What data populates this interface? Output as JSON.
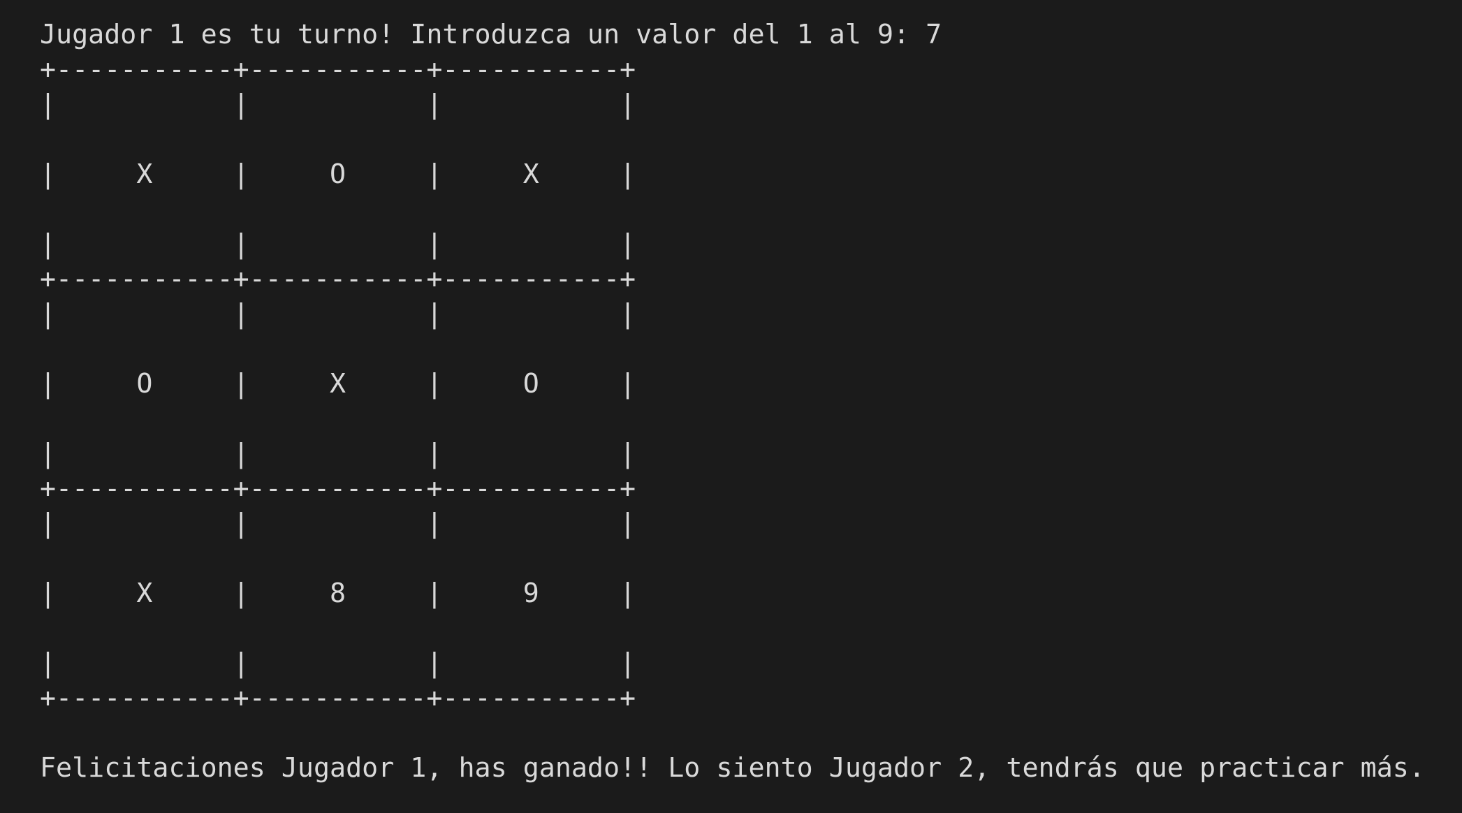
{
  "terminal": {
    "prompt_line": "Jugador 1 es tu turno! Introduzca un valor del 1 al 9: 7",
    "board": {
      "border_line": "+-----------+-----------+-----------+",
      "spacer_line": "|           |           |           |",
      "row1": "|     X     |     O     |     X     |",
      "row2": "|     O     |     X     |     O     |",
      "row3": "|     X     |     8     |     9     |",
      "cells": [
        "X",
        "O",
        "X",
        "O",
        "X",
        "O",
        "X",
        "8",
        "9"
      ]
    },
    "result_line": "Felicitaciones Jugador 1, has ganado!! Lo siento Jugador 2, tendrás que practicar más."
  },
  "colors": {
    "background": "#1b1b1b",
    "foreground": "#d9d9d9"
  }
}
